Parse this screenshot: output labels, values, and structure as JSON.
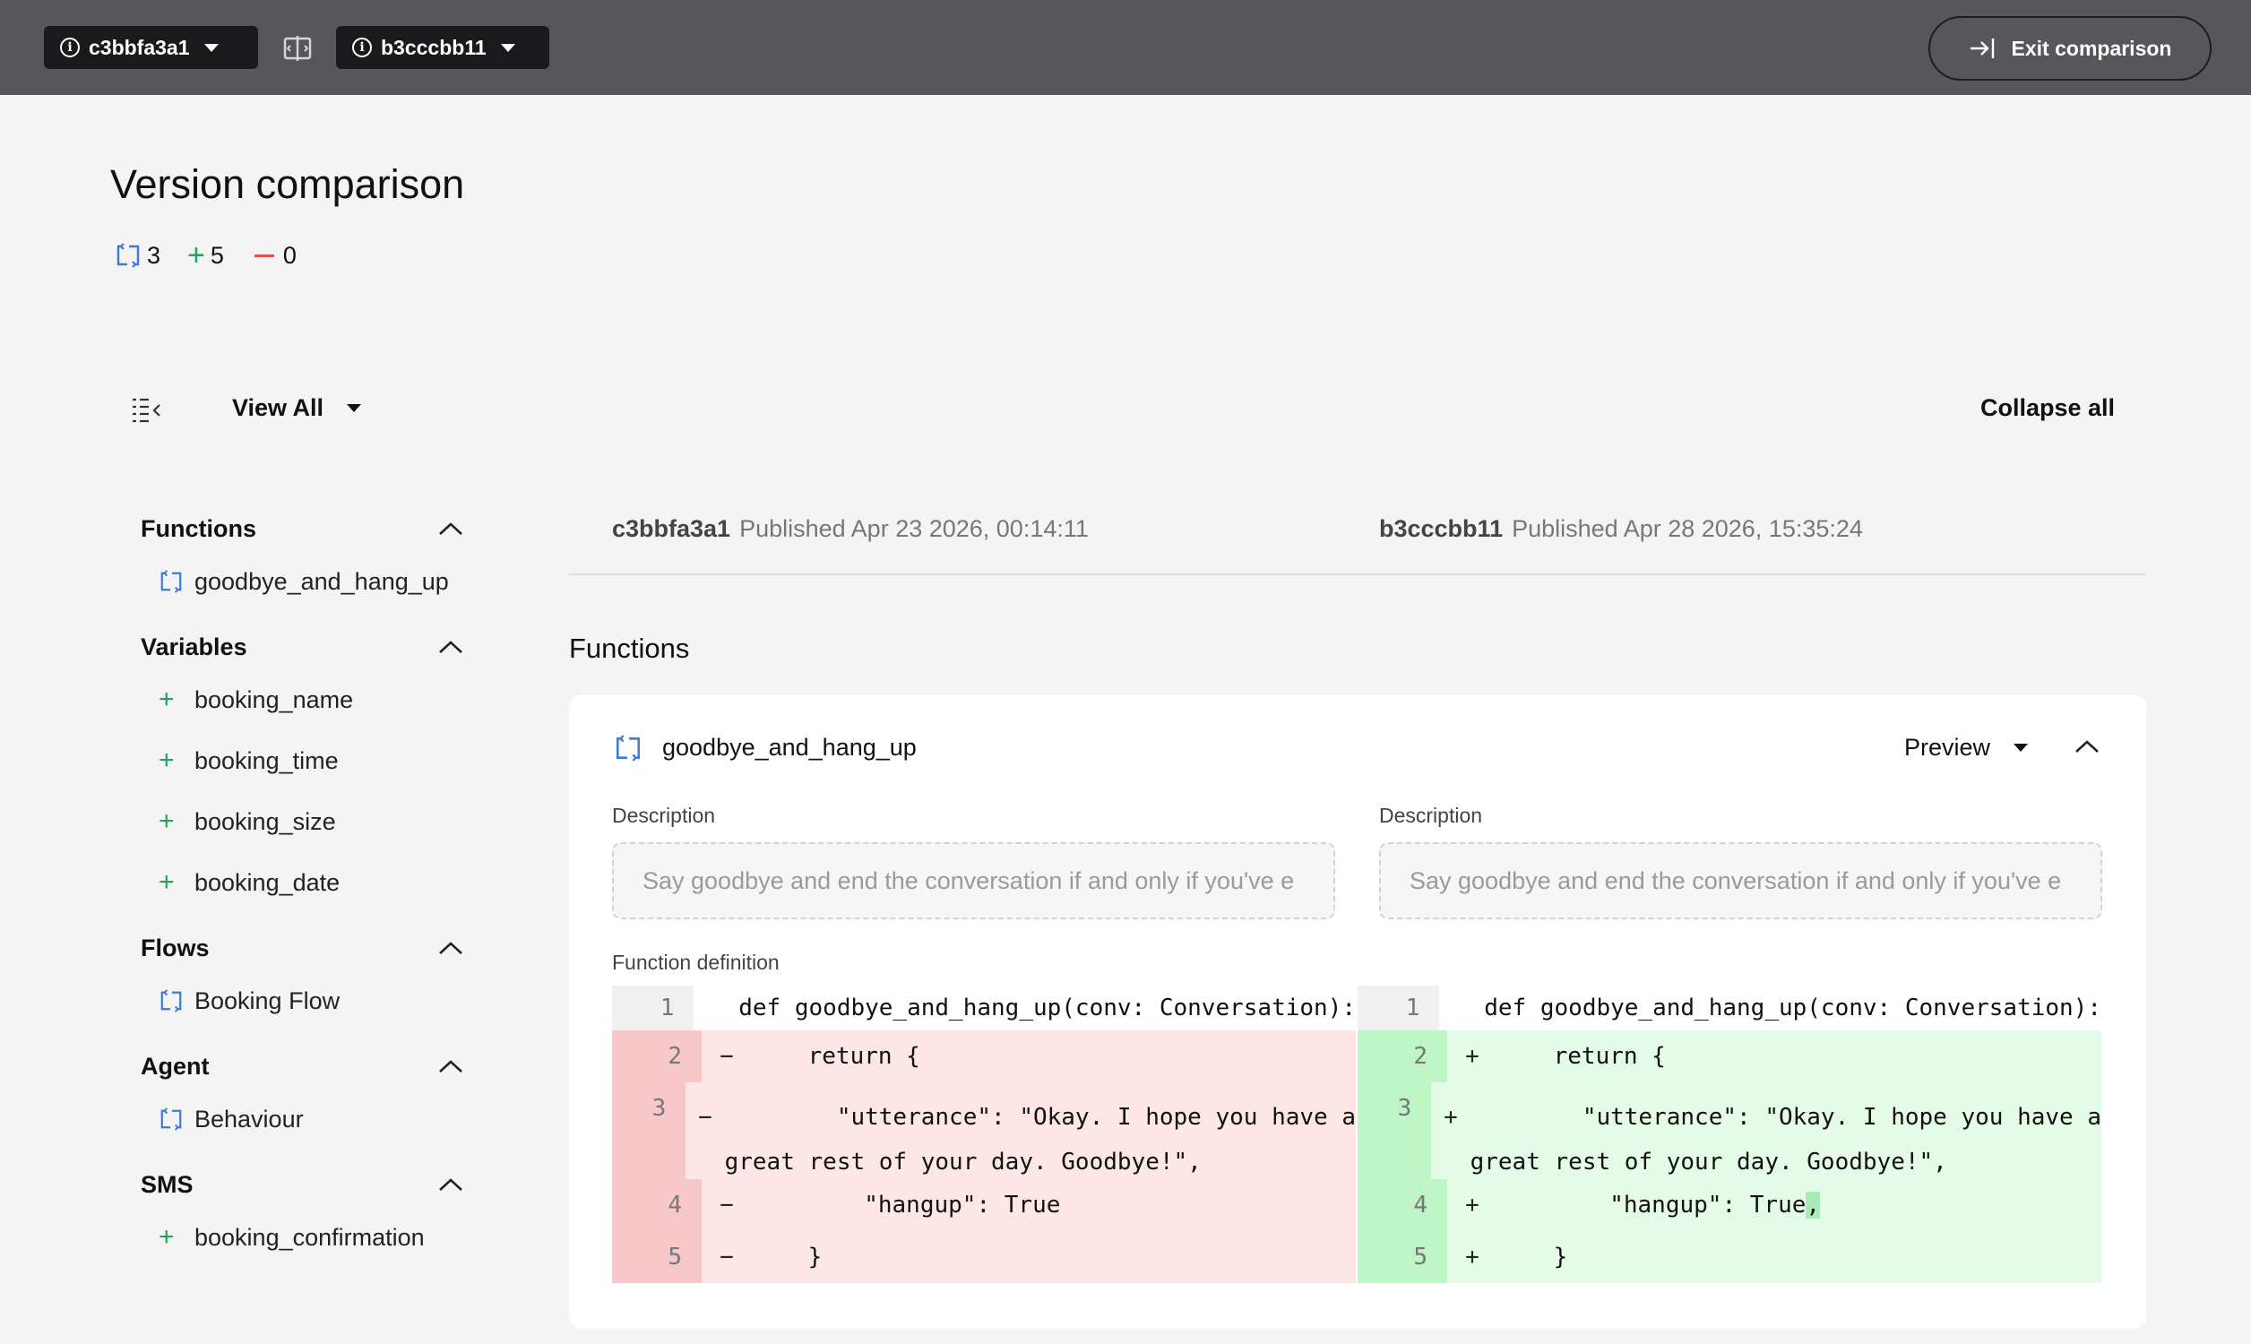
{
  "topbar": {
    "left_version": "c3bbfa3a1",
    "right_version": "b3cccbb11",
    "exit_label": "Exit comparison"
  },
  "header": {
    "title": "Version comparison",
    "modified_count": "3",
    "added_count": "5",
    "removed_count": "0"
  },
  "toolbar": {
    "view_label": "View All",
    "collapse_label": "Collapse all"
  },
  "sidebar": {
    "sections": [
      {
        "title": "Functions",
        "items": [
          {
            "label": "goodbye_and_hang_up",
            "kind": "modified"
          }
        ]
      },
      {
        "title": "Variables",
        "items": [
          {
            "label": "booking_name",
            "kind": "added"
          },
          {
            "label": "booking_time",
            "kind": "added"
          },
          {
            "label": "booking_size",
            "kind": "added"
          },
          {
            "label": "booking_date",
            "kind": "added"
          }
        ]
      },
      {
        "title": "Flows",
        "items": [
          {
            "label": "Booking Flow",
            "kind": "modified"
          }
        ]
      },
      {
        "title": "Agent",
        "items": [
          {
            "label": "Behaviour",
            "kind": "modified"
          }
        ]
      },
      {
        "title": "SMS",
        "items": [
          {
            "label": "booking_confirmation",
            "kind": "added"
          }
        ]
      }
    ]
  },
  "versions": {
    "left": {
      "id": "c3bbfa3a1",
      "published": "Published Apr 23 2026, 00:14:11"
    },
    "right": {
      "id": "b3cccbb11",
      "published": "Published Apr 28 2026, 15:35:24"
    }
  },
  "main": {
    "section_title": "Functions",
    "card": {
      "name": "goodbye_and_hang_up",
      "preview_label": "Preview",
      "description_label": "Description",
      "description_left": "Say goodbye and end the conversation if and only if you've e",
      "description_right": "Say goodbye and end the conversation if and only if you've e",
      "definition_label": "Function definition",
      "code_line1": "def goodbye_and_hang_up(conv: Conversation):",
      "code_line2": "    return {",
      "code_line3a": "        \"utterance\": \"Okay. I hope you have a",
      "code_line3b": "great rest of your day. Goodbye!\",",
      "code_line4": "        \"hangup\": True",
      "code_line4_added": ",",
      "code_line5": "    }",
      "sign_removed": "−",
      "sign_added": "+"
    }
  },
  "colors": {
    "topbar": "#56565b",
    "added": "#1fa659",
    "removed": "#e05252",
    "modified": "#3d7bd6"
  }
}
